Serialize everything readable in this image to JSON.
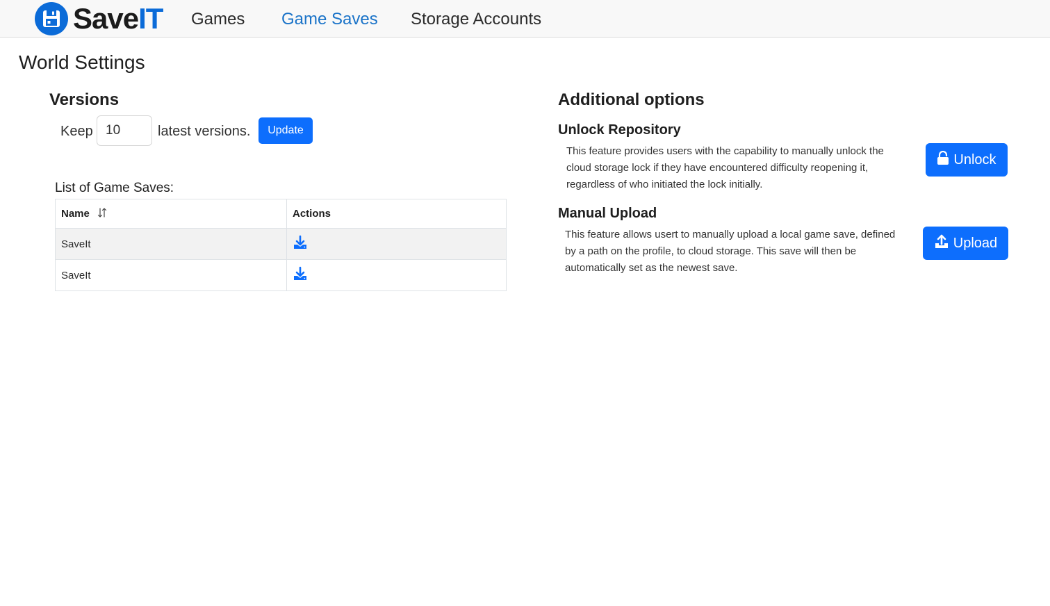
{
  "brand": {
    "part1": "Save",
    "part2": "IT",
    "logo_icon": "floppy-disk-icon",
    "accent": "#0b6bd8"
  },
  "nav": [
    {
      "label": "Games",
      "active": false
    },
    {
      "label": "Game Saves",
      "active": true
    },
    {
      "label": "Storage Accounts",
      "active": false
    }
  ],
  "page_title": "World Settings",
  "versions": {
    "heading": "Versions",
    "keep_label": "Keep",
    "count": "10",
    "suffix_label": "latest versions.",
    "update_label": "Update"
  },
  "saves_list": {
    "title": "List of Game Saves:",
    "columns": {
      "name": "Name",
      "actions": "Actions"
    },
    "sort_icon": "sort-arrows-icon",
    "rows": [
      {
        "name": "SaveIt",
        "action_icon": "download-icon"
      },
      {
        "name": "SaveIt",
        "action_icon": "download-icon"
      }
    ]
  },
  "additional": {
    "heading": "Additional options",
    "unlock": {
      "title": "Unlock Repository",
      "description": "This feature provides users with the capability to manually unlock the cloud storage lock if they have encountered difficulty reopening it, regardless of who initiated the lock initially.",
      "button_label": "Unlock",
      "icon": "unlock-icon"
    },
    "upload": {
      "title": "Manual Upload",
      "description": "This feature allows usert to manually upload a local game save, defined by a path on the profile, to cloud storage. This save will then be automatically set as the newest save.",
      "button_label": "Upload",
      "icon": "upload-icon"
    }
  },
  "colors": {
    "primary": "#0d6efd",
    "nav_active": "#1a73c8",
    "navbar_bg": "#f8f8f8",
    "row_stripe": "#f2f2f2"
  }
}
